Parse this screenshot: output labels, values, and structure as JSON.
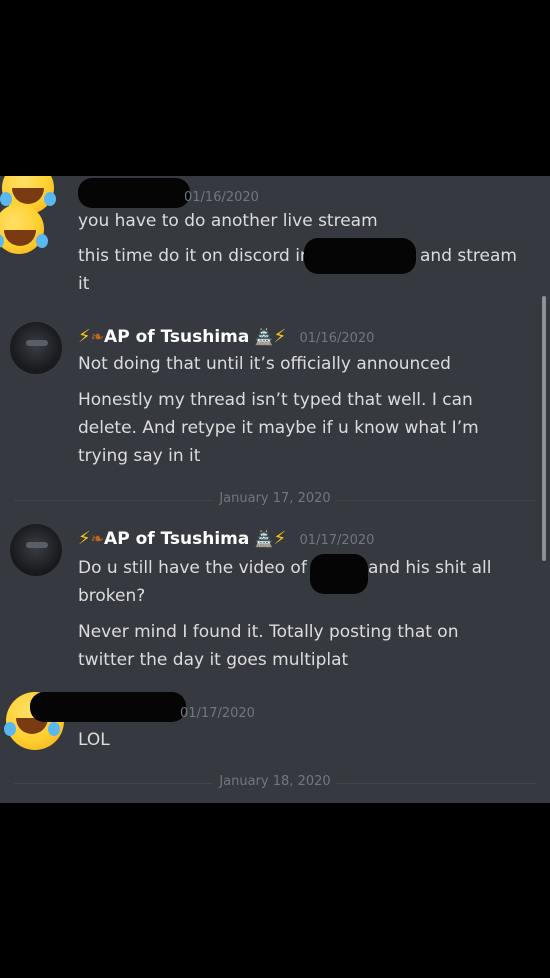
{
  "messages": [
    {
      "author": "",
      "timestamp": "01/16/2020",
      "lines": [
        "you have to do another live stream",
        "this time do it on discord in",
        "and stream",
        "it"
      ]
    },
    {
      "author": "AP of Tsushima",
      "timestamp": "01/16/2020",
      "lines": [
        "Not doing that until it’s officially announced",
        "Honestly my thread isn’t typed that well. I can",
        "delete. And retype it maybe if u know what I’m",
        "trying say in it"
      ]
    },
    {
      "author": "AP of Tsushima",
      "timestamp": "01/17/2020",
      "lines": [
        "Do u still have the video of",
        "and his shit all",
        "broken?",
        "Never mind I found it. Totally posting that on",
        "twitter the day it goes multiplat"
      ]
    },
    {
      "author": "",
      "timestamp": "01/17/2020",
      "lines": [
        "LOL"
      ]
    }
  ],
  "dividers": [
    "January 17, 2020",
    "January 18, 2020"
  ],
  "icons": {
    "bolt": "lightning-icon",
    "leaf": "leaf-icon",
    "castle": "castle-icon",
    "laugh_avatar": "tears-of-joy-emoji",
    "ninja_avatar": "ninja-avatar"
  },
  "colors": {
    "background": "#36393f",
    "text": "#dcddde",
    "timestamp": "#72767d",
    "bolt": "#f5c518"
  }
}
